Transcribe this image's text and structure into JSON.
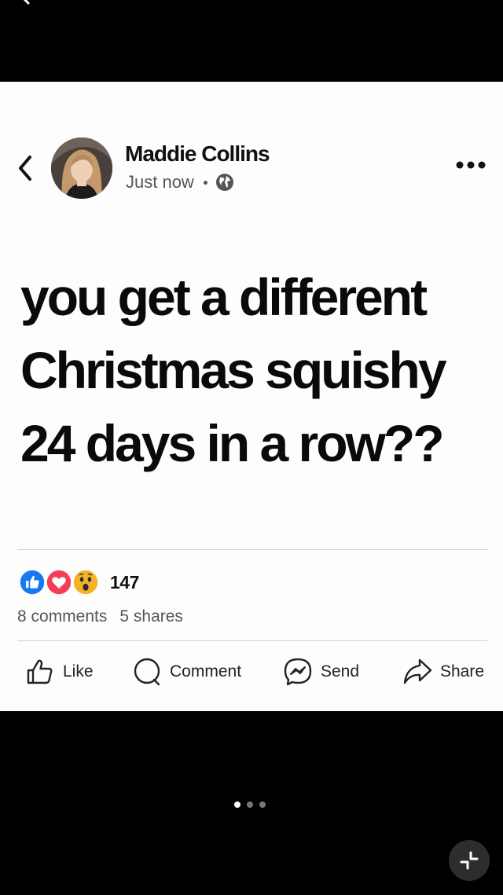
{
  "post": {
    "author": "Maddie Collins",
    "timestamp": "Just now",
    "audience_icon": "globe-icon",
    "text": "you get a different Christmas squishy 24 days in a row??",
    "reaction_count": "147",
    "comments": "8 comments",
    "shares": "5 shares"
  },
  "actions": {
    "like": "Like",
    "comment": "Comment",
    "send": "Send",
    "share": "Share"
  },
  "pager": {
    "total": 3,
    "active": 1
  },
  "colors": {
    "like_blue": "#1877f2",
    "love_red": "#f33e58",
    "wow_yellow": "#f7b125"
  }
}
